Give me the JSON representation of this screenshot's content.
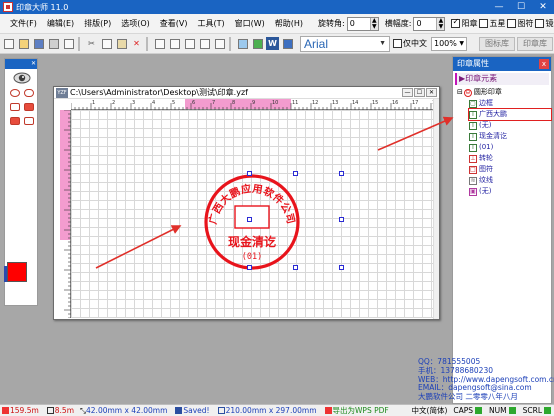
{
  "app": {
    "title": "印章大师 11.0"
  },
  "window_buttons": {
    "minimize": "—",
    "maximize": "☐",
    "close": "✕"
  },
  "menu": {
    "items": [
      "文件(F)",
      "编辑(E)",
      "排版(P)",
      "选项(O)",
      "查看(V)",
      "工具(T)",
      "窗口(W)",
      "帮助(H)"
    ],
    "rotation_label": "旋转角:",
    "rotation_value": "0",
    "scale_label": "横幅度:",
    "scale_value": "0",
    "checkboxes": [
      {
        "label": "阳章",
        "checked": true
      },
      {
        "label": "五星",
        "checked": false
      },
      {
        "label": "图符",
        "checked": false
      },
      {
        "label": "镜像",
        "checked": false
      }
    ]
  },
  "toolbar": {
    "font": "Arial",
    "chinese_only_label": "仅中文",
    "chinese_only_checked": false,
    "zoom": "100%",
    "font_lib_button": "图标库",
    "seal_lib_button": "印章库"
  },
  "document": {
    "path": "C:\\Users\\Administrator\\Desktop\\测试\\印章.yzf",
    "icon_text": "YZF",
    "ruler_marks": [
      "1",
      "2",
      "3",
      "4",
      "5",
      "6",
      "7",
      "8",
      "9",
      "10",
      "11",
      "12",
      "13",
      "14",
      "15",
      "16",
      "17",
      "18"
    ]
  },
  "stamp": {
    "top_text": "广西大鹏应用软件公司",
    "center_text": "现金清讫",
    "number_text": "(01)",
    "color": "#e8141c"
  },
  "props_panel": {
    "title": "印章属性",
    "close": "x",
    "section": "印章元素",
    "tree": [
      {
        "label": "圆形印章",
        "level": 0,
        "icon": "seal-circle",
        "selected": false
      },
      {
        "label": "边框",
        "level": 1,
        "icon": "border",
        "selected": false
      },
      {
        "label": "广西大鹏",
        "level": 1,
        "icon": "text-arc",
        "selected": true
      },
      {
        "label": "(无)",
        "level": 1,
        "icon": "text-arc",
        "selected": false
      },
      {
        "label": "现金清讫",
        "level": 1,
        "icon": "text",
        "selected": false
      },
      {
        "label": "(01)",
        "level": 1,
        "icon": "text",
        "selected": false
      },
      {
        "label": "转轮",
        "level": 1,
        "icon": "wheel",
        "selected": false
      },
      {
        "label": "图符",
        "level": 1,
        "icon": "symbol",
        "selected": false
      },
      {
        "label": "纹线",
        "level": 1,
        "icon": "lines",
        "selected": false
      },
      {
        "label": "(无)",
        "level": 1,
        "icon": "image",
        "selected": false
      }
    ]
  },
  "contact": {
    "qq": "QQ：781555005",
    "phone": "手机：13788680230",
    "web": "WEB：http://www.dapengsoft.com.cn",
    "email": "EMAIL：dapengsoft@sina.com",
    "company": "大鹏软件公司 二零零八年八月"
  },
  "status": {
    "x": "159.5m",
    "y": "8.5m",
    "stamp_size": "42.00mm x 42.00mm",
    "saved": "Saved!",
    "page_size": "210.00mm x 297.00mm",
    "export": "导出为WPS PDF",
    "lang": "中文(简体)",
    "caps": "CAPS",
    "num": "NUM",
    "scrl": "SCRL"
  },
  "colors": {
    "titlebar": "#1a64c2",
    "highlight": "#f39ccf",
    "seal_red": "#e8141c",
    "link_blue": "#1b3fb8"
  }
}
